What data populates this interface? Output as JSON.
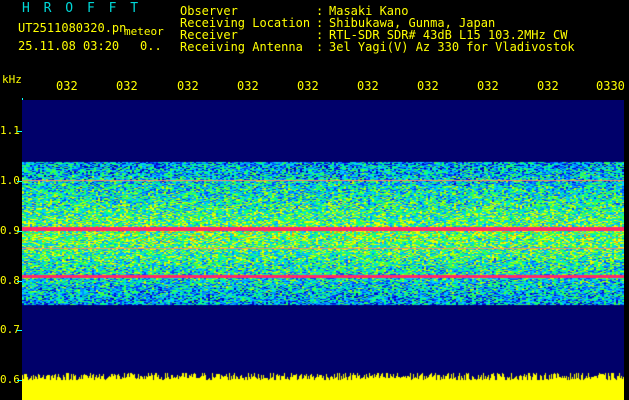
{
  "header": {
    "app_title": "H R O F F T",
    "filename": "UT2511080320.pn",
    "subname": "meteor",
    "datetime": "25.11.08 03:20",
    "counter": "0..",
    "info": [
      {
        "label": "Observer",
        "value": "Masaki Kano"
      },
      {
        "label": "Receiving Location",
        "value": "Shibukawa, Gunma, Japan"
      },
      {
        "label": "Receiver",
        "value": "RTL-SDR SDR# 43dB L15 103.2MHz CW"
      },
      {
        "label": "Receiving Antenna",
        "value": "3el Yagi(V) Az 330 for Vladivostok"
      }
    ],
    "separator": ":"
  },
  "time_axis": {
    "ticks": [
      "032",
      "032",
      "032",
      "032",
      "032",
      "032",
      "032",
      "032",
      "032",
      "0330"
    ]
  },
  "freq_axis": {
    "unit": "kHz",
    "ticks": [
      "1.1",
      "1.0",
      "0.9",
      "0.8",
      "0.7",
      "0.6"
    ]
  },
  "colors": {
    "background": "#000000",
    "plot_background": "#00006a",
    "text": "#ffff00",
    "title": "#00d8d8",
    "axis": "#00ffff",
    "noise_band": "#ffff00",
    "carrier": "#ff2a6a"
  }
}
